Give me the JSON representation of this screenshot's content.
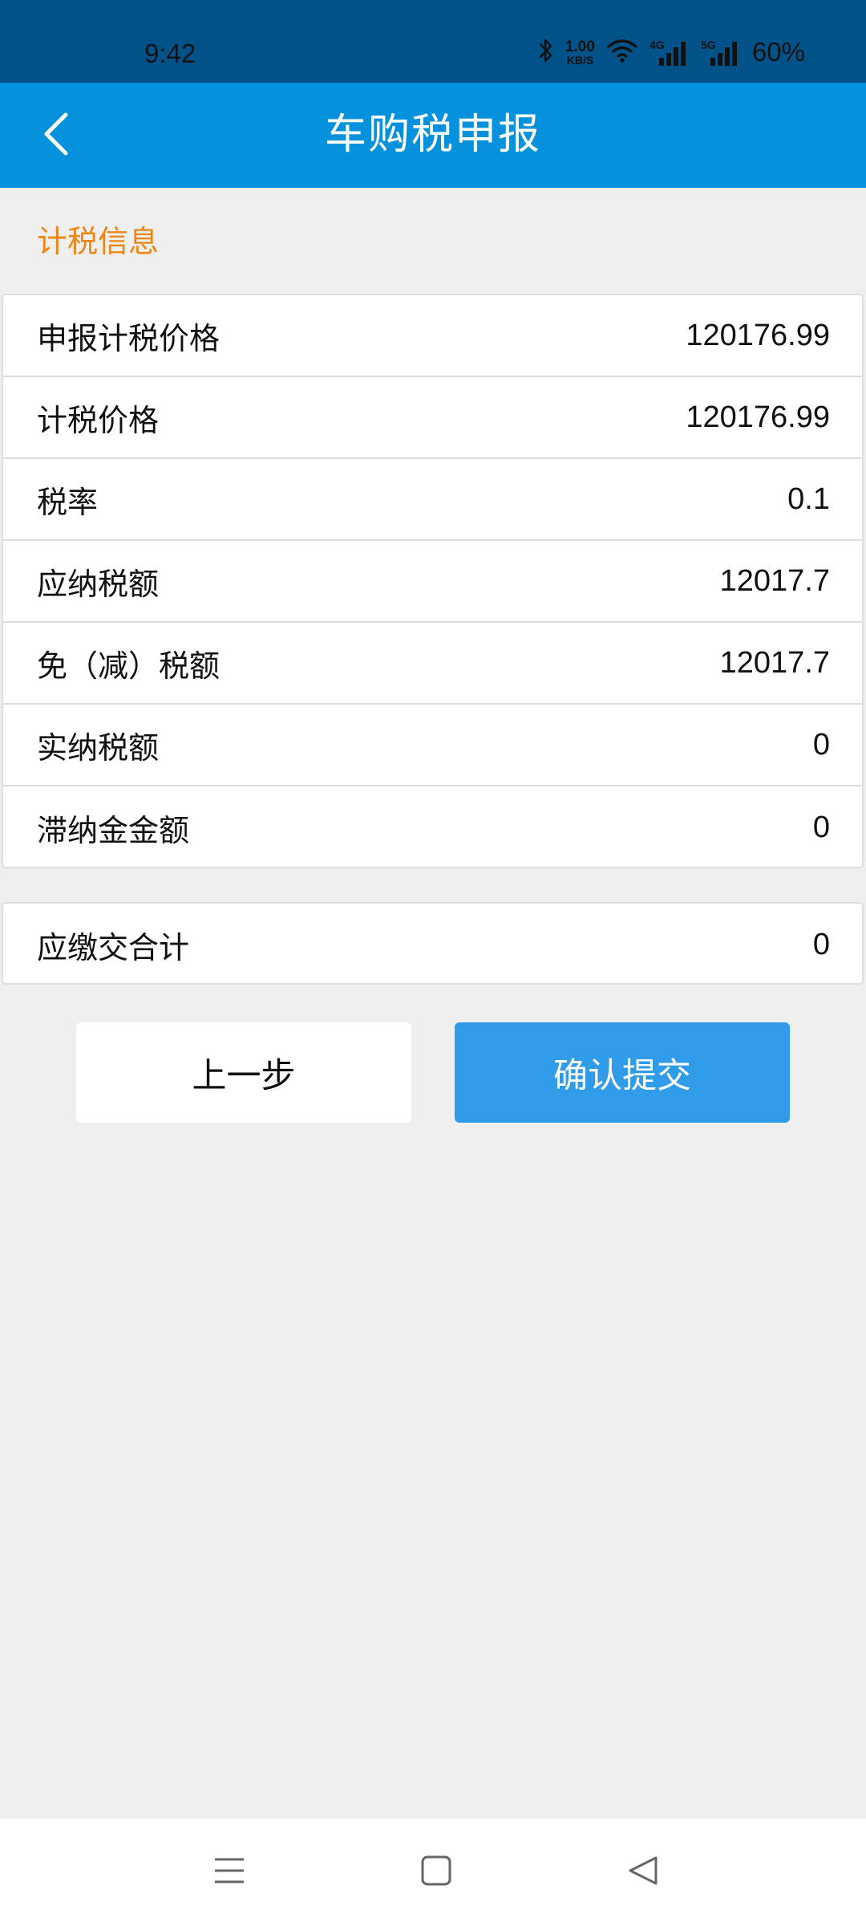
{
  "status_bar": {
    "time": "9:42",
    "net_speed_value": "1.00",
    "net_speed_unit": "KB/S",
    "signal_1": "4G",
    "signal_2": "5G",
    "battery": "60%"
  },
  "app_bar": {
    "title": "车购税申报"
  },
  "section": {
    "label": "计税信息"
  },
  "tax_rows": [
    {
      "label": "申报计税价格",
      "value": "120176.99"
    },
    {
      "label": "计税价格",
      "value": "120176.99"
    },
    {
      "label": "税率",
      "value": "0.1"
    },
    {
      "label": "应纳税额",
      "value": "12017.7"
    },
    {
      "label": "免（减）税额",
      "value": "12017.7"
    },
    {
      "label": "实纳税额",
      "value": "0"
    },
    {
      "label": "滞纳金金额",
      "value": "0"
    }
  ],
  "total": {
    "label": "应缴交合计",
    "value": "0"
  },
  "buttons": {
    "prev_label": "上一步",
    "submit_label": "确认提交"
  },
  "colors": {
    "status_bar": "#02528a",
    "app_bar": "#0691dc",
    "section_label": "#ef8514",
    "submit_button": "#2f9be9",
    "background": "#efefef"
  },
  "icons": {
    "back": "chevron-left-icon",
    "bluetooth": "bluetooth-icon",
    "wifi": "wifi-icon",
    "nav_menu": "menu-icon",
    "nav_home": "square-icon",
    "nav_back": "triangle-back-icon"
  }
}
